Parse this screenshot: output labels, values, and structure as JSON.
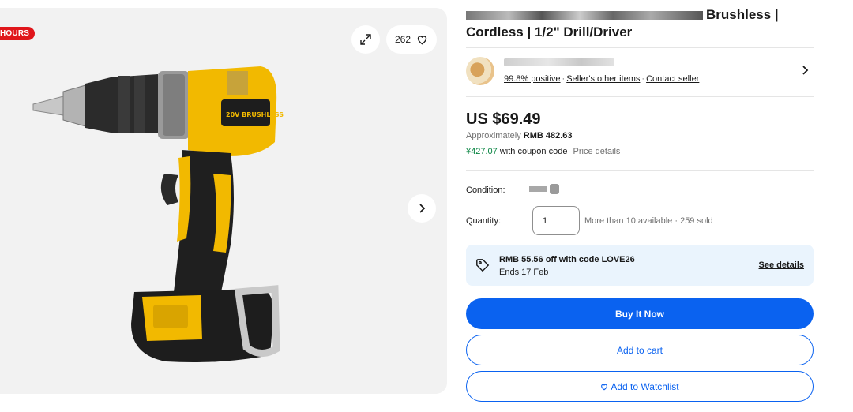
{
  "gallery": {
    "badge": "HOURS",
    "watch_count": "262"
  },
  "listing": {
    "title_line1_visible": "Brushless |",
    "title_line2": "Cordless | 1/2\" Drill/Driver",
    "seller": {
      "positive": "99.8% positive",
      "other_items": "Seller's other items",
      "contact": "Contact seller"
    },
    "price": "US $69.49",
    "approx_prefix": "Approximately",
    "approx_value": "RMB 482.63",
    "coupon_price": "¥427.07",
    "coupon_text": "with coupon code",
    "price_details": "Price details",
    "condition_label": "Condition:",
    "quantity_label": "Quantity:",
    "quantity_value": "1",
    "availability": "More than 10 available · 259 sold",
    "promo": {
      "main": "RMB 55.56 off with code LOVE26",
      "sub": "Ends 17 Feb",
      "link": "See details"
    },
    "buttons": {
      "buy_now": "Buy It Now",
      "add_to_cart": "Add to cart",
      "add_to_watchlist": "Add to Watchlist"
    }
  },
  "colors": {
    "primary": "#0a62f0",
    "badge": "#e0161b",
    "green": "#05823f",
    "promo_bg": "#eaf4fd"
  }
}
